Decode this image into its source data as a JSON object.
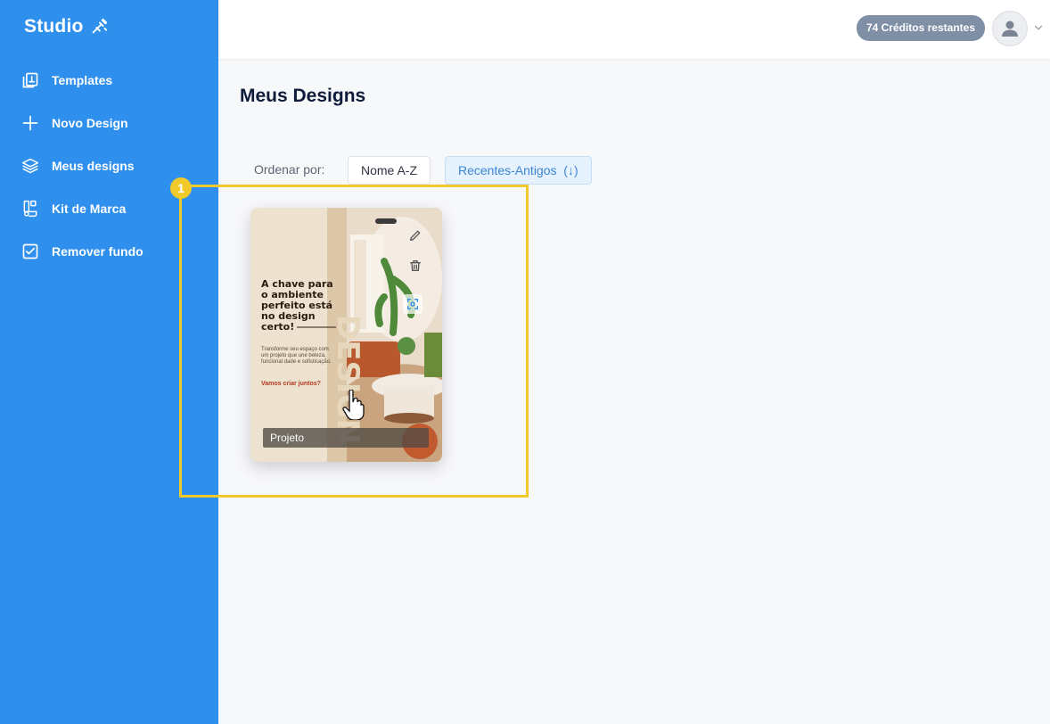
{
  "app": {
    "logo_text": "Studio"
  },
  "sidebar": {
    "items": [
      {
        "label": "Templates",
        "icon": "templates-icon"
      },
      {
        "label": "Novo Design",
        "icon": "plus-icon"
      },
      {
        "label": "Meus designs",
        "icon": "layers-icon"
      },
      {
        "label": "Kit de Marca",
        "icon": "brand-kit-icon"
      },
      {
        "label": "Remover fundo",
        "icon": "check-square-icon"
      }
    ]
  },
  "header": {
    "credits": "74 Créditos restantes",
    "avatar_icon": "user-icon",
    "menu_icon": "chevron-down-icon"
  },
  "main": {
    "title": "Meus Designs",
    "sort_label": "Ordenar por:",
    "sort_options": {
      "az": "Nome A-Z",
      "recent": "Recentes-Antigos  (↓)"
    },
    "selected_sort": "recent"
  },
  "annotation": {
    "badge": "1",
    "color": "#f0c92a"
  },
  "designs": [
    {
      "name": "Projeto",
      "headline": "A chave para o ambiente perfeito está no design certo!",
      "subtext": "Transforme seu espaço com um projeto que une beleza, funcional dade e sofisticação.",
      "cta": "Vamos criar juntos?"
    }
  ],
  "colors": {
    "sidebar": "#2e8fec",
    "accent": "#3a86d4",
    "credits_bg": "#7e8fa6"
  }
}
